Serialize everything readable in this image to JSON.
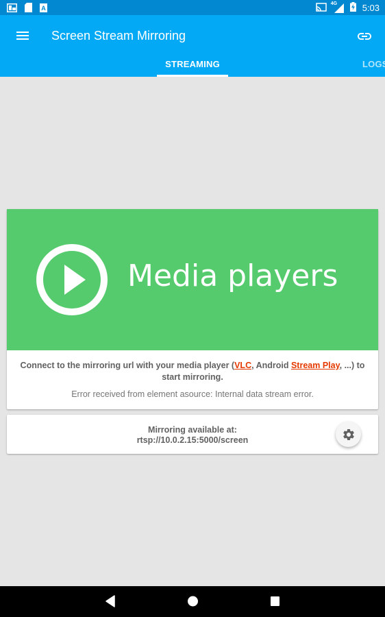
{
  "status_bar": {
    "left_icons": [
      "screen-mirror-icon",
      "sd-card-icon",
      "font-a-icon"
    ],
    "right_icons": [
      "cast-icon",
      "signal-4g-icon",
      "battery-charging-icon"
    ],
    "network_label": "4G",
    "time": "5:03"
  },
  "app_bar": {
    "title": "Screen Stream Mirroring",
    "menu_icon": "hamburger-menu-icon",
    "action_icon": "link-icon"
  },
  "tabs": [
    {
      "label": "STREAMING",
      "active": true
    },
    {
      "label": "LOGS",
      "active": false
    }
  ],
  "main_card": {
    "banner_text": "Media players",
    "banner_color": "#55cb6d",
    "connect_prefix": "Connect to the mirroring url with your media player (",
    "link_vlc": "VLC",
    "connect_middle": ", Android ",
    "link_stream_play": "Stream Play",
    "connect_suffix": ", ...) to start mirroring.",
    "error_message": "Error received from element asource: Internal data stream error."
  },
  "url_card": {
    "label": "Mirroring available at:",
    "url": "rtsp://10.0.2.15:5000/screen",
    "settings_icon": "gear-icon"
  },
  "colors": {
    "status_bar": "#0288d1",
    "app_bar": "#03a9f4",
    "link": "#e53900",
    "background": "#e5e5e5"
  }
}
